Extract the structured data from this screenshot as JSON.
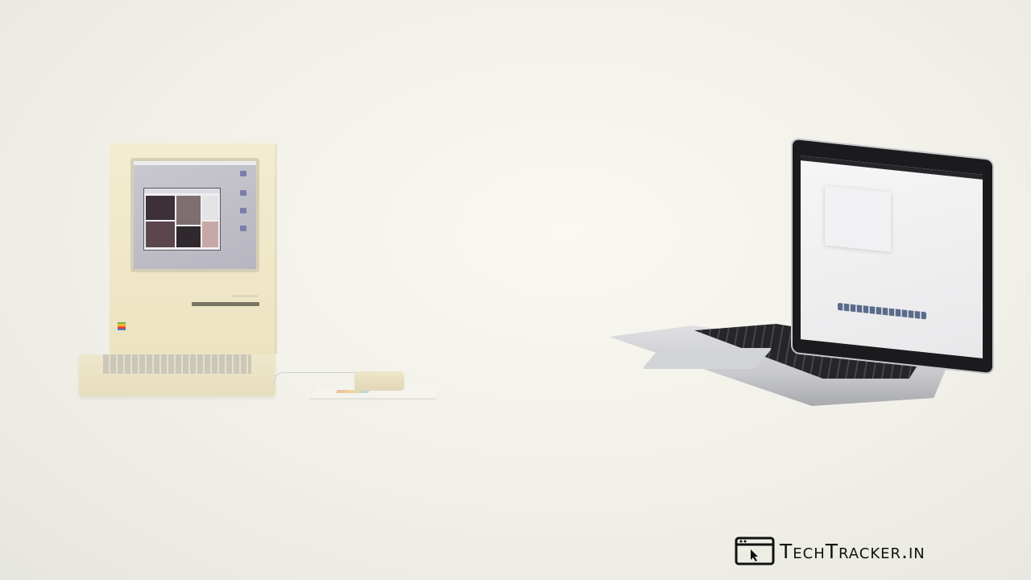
{
  "watermark": {
    "text": "TechTracker.in",
    "icon": "browser-cursor-icon",
    "color": "#111111"
  },
  "scene": {
    "background_color": "#f2f1ea",
    "vintage_computer_color": "#efe7c8",
    "laptop_color": "#c8c9cd"
  }
}
